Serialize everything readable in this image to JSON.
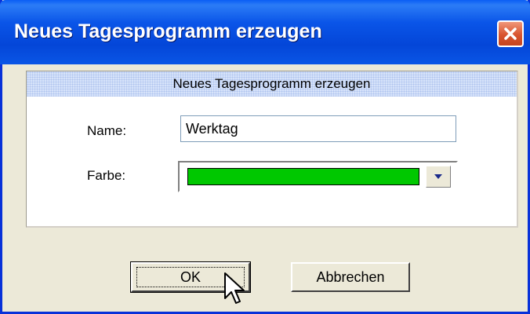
{
  "window": {
    "title": "Neues Tagesprogramm erzeugen",
    "close_icon": "close-icon"
  },
  "panel": {
    "header": "Neues Tagesprogramm erzeugen"
  },
  "form": {
    "name_label": "Name:",
    "name_value": "Werktag",
    "color_label": "Farbe:",
    "color_value": "#00c800",
    "dropdown_icon": "chevron-down-icon"
  },
  "buttons": {
    "ok_label": "OK",
    "cancel_label": "Abbrechen"
  },
  "colors": {
    "titlebar": "#0a55e8",
    "dialog_bg": "#ece9d8",
    "panel_header": "#d7e3fa",
    "close_button": "#d8542f"
  }
}
